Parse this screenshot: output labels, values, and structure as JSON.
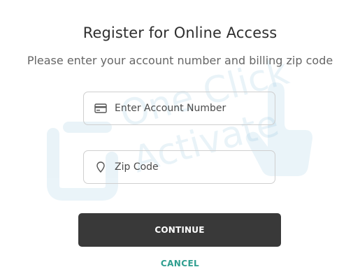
{
  "page": {
    "title": "Register for Online Access",
    "subtitle": "Please enter your account number and billing zip code"
  },
  "form": {
    "account_number": {
      "placeholder": "Enter Account Number",
      "icon": "credit-card-icon"
    },
    "zip_code": {
      "placeholder": "Zip Code",
      "icon": "location-pin-icon"
    }
  },
  "actions": {
    "continue_label": "CONTINUE",
    "cancel_label": "CANCEL"
  },
  "watermark": {
    "text_line1": "One Click",
    "text_line2": "Activate"
  },
  "colors": {
    "primary_button": "#393939",
    "link": "#2f9e8f",
    "watermark": "#6aaed1"
  }
}
